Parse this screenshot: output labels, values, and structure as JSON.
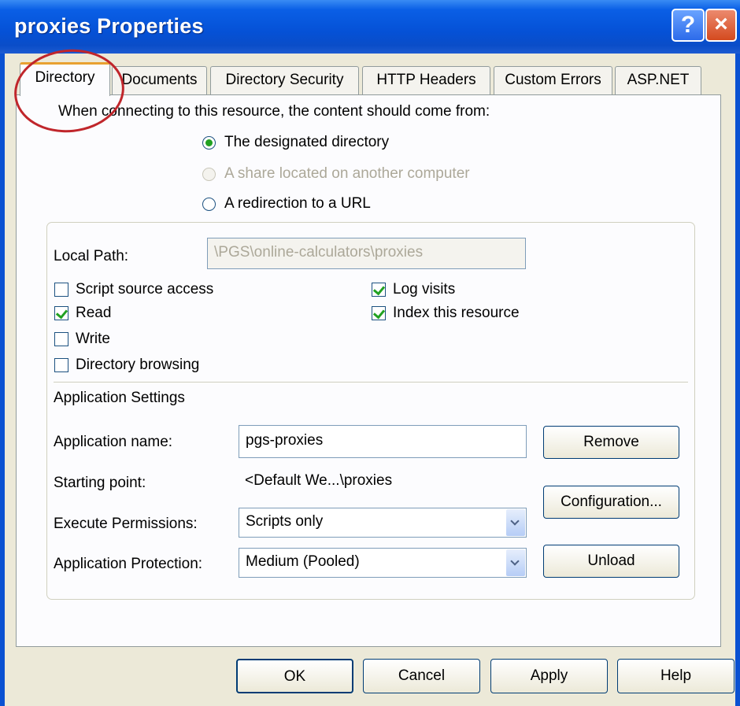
{
  "window": {
    "title": "proxies Properties",
    "help_label": "?",
    "close_label": "×"
  },
  "tabs": [
    {
      "label": "Directory",
      "active": true
    },
    {
      "label": "Documents",
      "active": false
    },
    {
      "label": "Directory Security",
      "active": false
    },
    {
      "label": "HTTP Headers",
      "active": false
    },
    {
      "label": "Custom Errors",
      "active": false
    },
    {
      "label": "ASP.NET",
      "active": false
    }
  ],
  "content_source": {
    "prompt": "When connecting to this resource, the content should come from:",
    "options": [
      {
        "label": "The designated directory",
        "selected": true,
        "enabled": true
      },
      {
        "label": "A share located on another computer",
        "selected": false,
        "enabled": false
      },
      {
        "label": "A redirection to a URL",
        "selected": false,
        "enabled": true
      }
    ]
  },
  "local_path": {
    "label": "Local Path:",
    "value": "\\PGS\\online-calculators\\proxies"
  },
  "permissions": {
    "script_source_access": {
      "label": "Script source access",
      "checked": false
    },
    "read": {
      "label": "Read",
      "checked": true
    },
    "write": {
      "label": "Write",
      "checked": false
    },
    "directory_browsing": {
      "label": "Directory browsing",
      "checked": false
    },
    "log_visits": {
      "label": "Log visits",
      "checked": true
    },
    "index_resource": {
      "label": "Index this resource",
      "checked": true
    }
  },
  "app_settings": {
    "heading": "Application Settings",
    "app_name_label": "Application name:",
    "app_name_value": "pgs-proxies",
    "starting_point_label": "Starting point:",
    "starting_point_value": "<Default We...\\proxies",
    "exec_perm_label": "Execute Permissions:",
    "exec_perm_value": "Scripts only",
    "app_protection_label": "Application Protection:",
    "app_protection_value": "Medium (Pooled)",
    "remove_label": "Remove",
    "configuration_label": "Configuration...",
    "unload_label": "Unload"
  },
  "footer": {
    "ok_label": "OK",
    "cancel_label": "Cancel",
    "apply_label": "Apply",
    "help_label": "Help"
  },
  "colors": {
    "title_bar": "#0551d6",
    "dialog_bg": "#ece9d8",
    "check_green": "#21a121",
    "annotation_red": "#c0262b"
  }
}
